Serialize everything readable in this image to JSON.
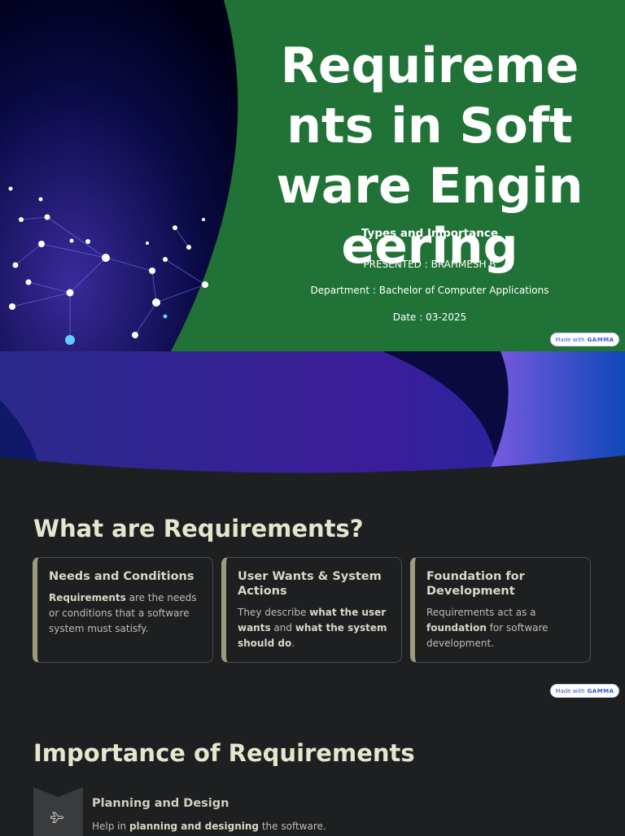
{
  "hero": {
    "title": "Requirements in Software Engineering",
    "subtitle": "Types and Importance",
    "presenter": "PRESENTED : BRAHMESH B",
    "department": "Department : Bachelor of Computer Applications",
    "date": "Date : 03-2025"
  },
  "badge": {
    "made_with": "Made with",
    "brand": "GAMMA"
  },
  "section1": {
    "heading": "What are Requirements?",
    "cards": [
      {
        "title": "Needs and Conditions",
        "bold": "Requirements",
        "text": " are the needs or conditions that a software system must satisfy."
      },
      {
        "title": "User Wants & System Actions",
        "pre": "They describe ",
        "b1": "what the user wants",
        "mid": " and ",
        "b2": "what the system should do",
        "post": "."
      },
      {
        "title": "Foundation for Development",
        "pre": "Requirements act as a ",
        "b1": "foundation",
        "post": " for software development."
      }
    ]
  },
  "section2": {
    "heading": "Importance of Requirements",
    "items": [
      {
        "title": "Planning and Design",
        "pre": "Help in ",
        "bold": "planning and designing",
        "post": " the software.",
        "icon": "airplane-icon"
      }
    ]
  }
}
